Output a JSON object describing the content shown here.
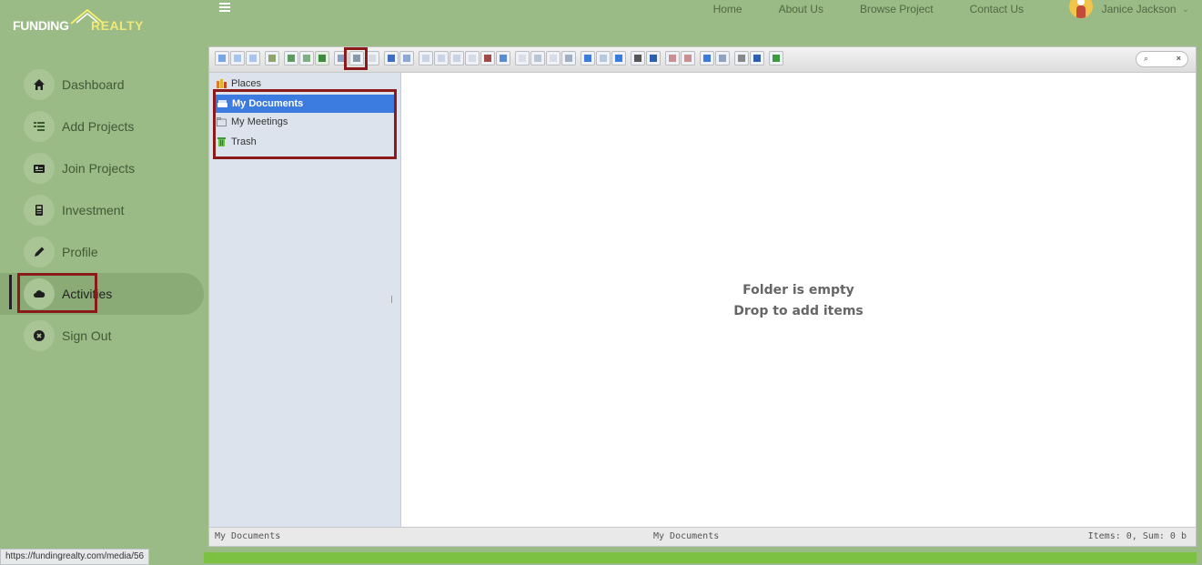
{
  "brand": {
    "part1": "FUNDING",
    "part2": "REALTY"
  },
  "topnav": {
    "menu_icon": "hamburger-icon",
    "links": [
      "Home",
      "About Us",
      "Browse Project",
      "Contact Us"
    ],
    "user_name": "Janice Jackson",
    "user_caret": "⌄"
  },
  "sidebar": {
    "items": [
      {
        "label": "Dashboard",
        "icon": "home-icon"
      },
      {
        "label": "Add Projects",
        "icon": "list-icon"
      },
      {
        "label": "Join Projects",
        "icon": "id-card-icon"
      },
      {
        "label": "Investment",
        "icon": "calculator-icon"
      },
      {
        "label": "Profile",
        "icon": "pencil-icon"
      },
      {
        "label": "Activities",
        "icon": "cloud-icon",
        "active": true
      },
      {
        "label": "Sign Out",
        "icon": "power-icon"
      }
    ]
  },
  "file_manager": {
    "search_icon": "⌕",
    "search_clear": "×",
    "tree": {
      "places": "Places",
      "items": [
        "My Documents",
        "My Meetings",
        "Trash"
      ],
      "selected": "My Documents"
    },
    "empty_line1": "Folder is empty",
    "empty_line2": "Drop to add items",
    "status_left": "My Documents",
    "status_center": "My Documents",
    "status_right": "Items: 0, Sum: 0 b"
  },
  "status_url": "https://fundingrealty.com/media/56",
  "colors": {
    "background": "#9aba86",
    "active_nav": "#8aab76",
    "highlight_border": "#8b1a1a",
    "selection": "#3c7be0",
    "footer_bar": "#7dc142"
  }
}
